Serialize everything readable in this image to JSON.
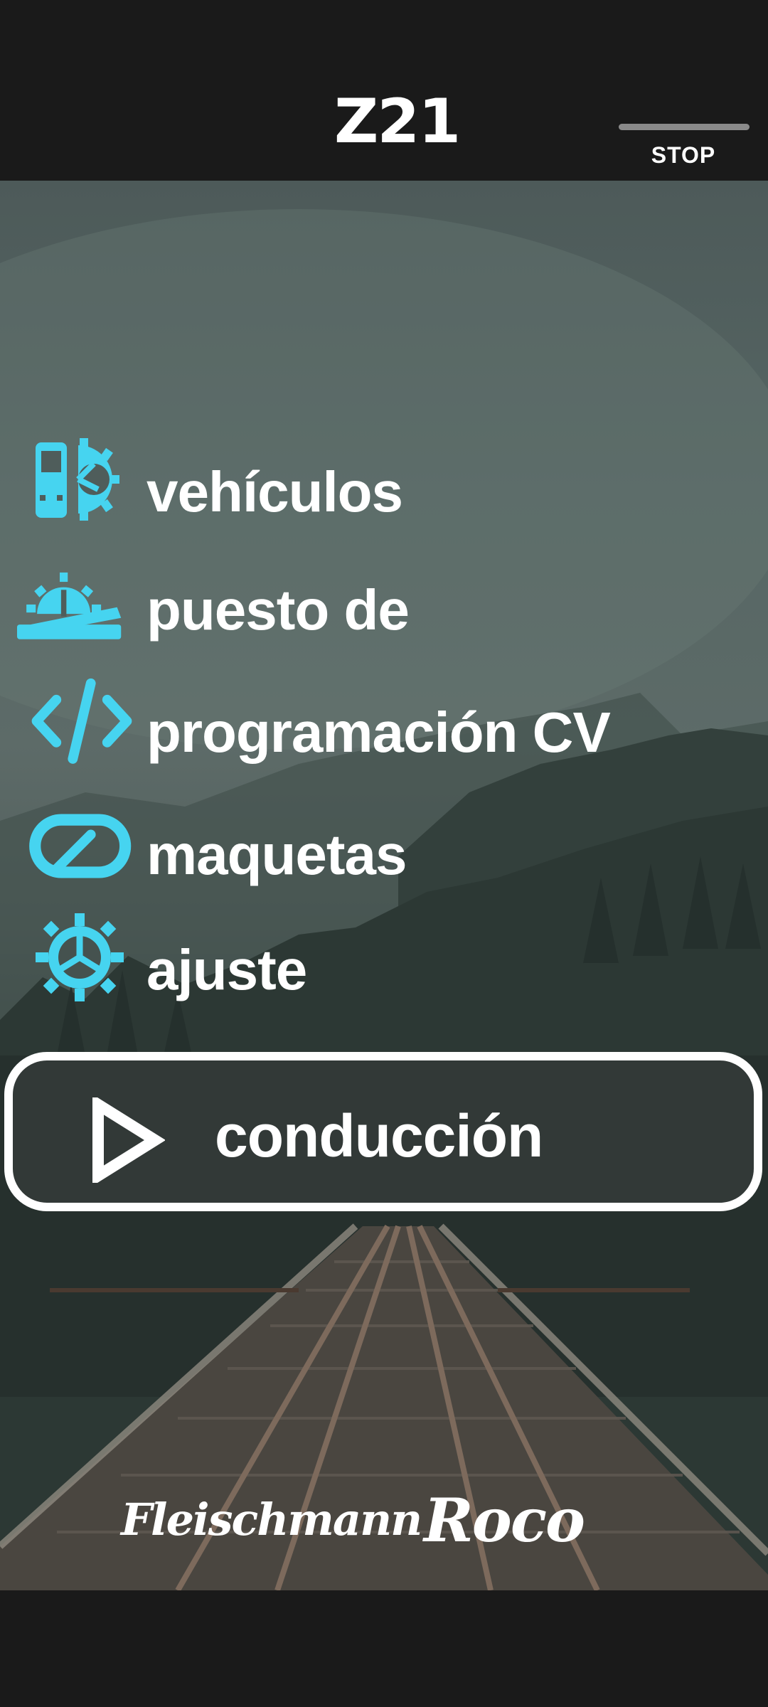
{
  "header": {
    "logo_text": "Z21",
    "stop_label": "STOP"
  },
  "menu": {
    "items": [
      {
        "label": "vehículos",
        "icon": "locomotive-gear-icon"
      },
      {
        "label": "puesto de",
        "icon": "switchboard-gear-icon"
      },
      {
        "label": "programación CV",
        "icon": "code-brackets-icon"
      },
      {
        "label": "maquetas",
        "icon": "track-loop-icon"
      },
      {
        "label": "ajuste",
        "icon": "settings-gear-icon"
      }
    ]
  },
  "drive": {
    "label": "conducción",
    "icon": "play-icon"
  },
  "brands": {
    "left": "Fleischmann",
    "right": "Roco"
  },
  "colors": {
    "accent": "#46d4f0",
    "bar": "#1a1a1a",
    "text": "#ffffff"
  }
}
